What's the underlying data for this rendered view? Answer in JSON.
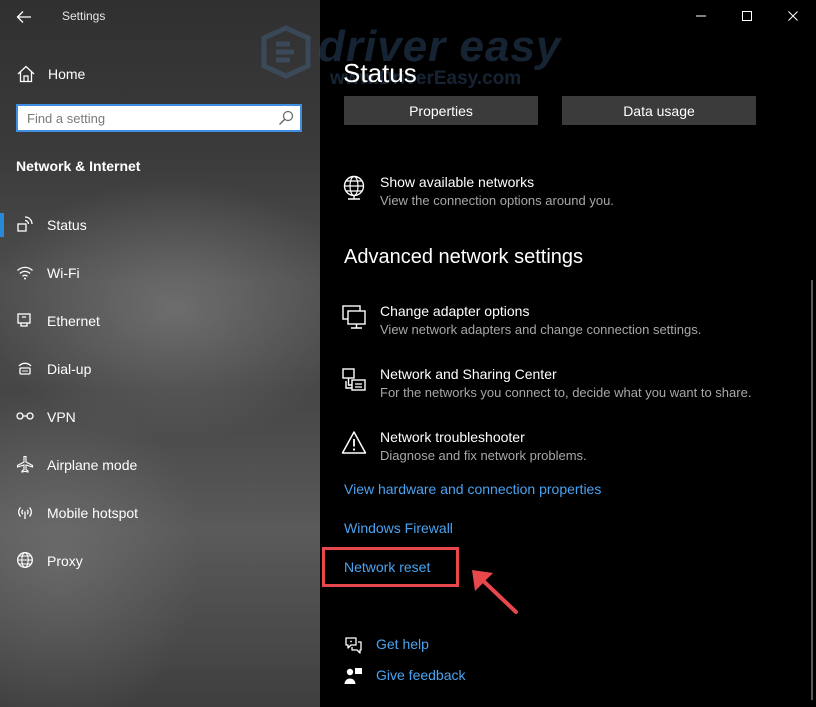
{
  "window": {
    "app_title": "Settings",
    "controls": [
      "minimize",
      "maximize",
      "close"
    ]
  },
  "watermark": {
    "brand": "driver easy",
    "url": "www.DriverEasy.com"
  },
  "sidebar": {
    "home_label": "Home",
    "search_placeholder": "Find a setting",
    "search_value": "",
    "section_title": "Network & Internet",
    "items": [
      {
        "label": "Status",
        "icon": "status-icon",
        "active": true
      },
      {
        "label": "Wi-Fi",
        "icon": "wifi-icon"
      },
      {
        "label": "Ethernet",
        "icon": "ethernet-icon"
      },
      {
        "label": "Dial-up",
        "icon": "dialup-icon"
      },
      {
        "label": "VPN",
        "icon": "vpn-icon"
      },
      {
        "label": "Airplane mode",
        "icon": "airplane-icon"
      },
      {
        "label": "Mobile hotspot",
        "icon": "hotspot-icon"
      },
      {
        "label": "Proxy",
        "icon": "globe-icon"
      }
    ]
  },
  "main": {
    "title": "Status",
    "buttons": {
      "properties": "Properties",
      "data_usage": "Data usage"
    },
    "show_networks": {
      "title": "Show available networks",
      "desc": "View the connection options around you."
    },
    "advanced_title": "Advanced network settings",
    "options": [
      {
        "title": "Change adapter options",
        "desc": "View network adapters and change connection settings.",
        "icon": "adapter-icon"
      },
      {
        "title": "Network and Sharing Center",
        "desc": "For the networks you connect to, decide what you want to share.",
        "icon": "sharing-center-icon"
      },
      {
        "title": "Network troubleshooter",
        "desc": "Diagnose and fix network problems.",
        "icon": "warning-icon"
      }
    ],
    "links": {
      "hardware": "View hardware and connection properties",
      "firewall": "Windows Firewall",
      "reset": "Network reset"
    },
    "help": {
      "get_help": "Get help",
      "feedback": "Give feedback"
    }
  },
  "colors": {
    "accent": "#2b88d8",
    "link": "#4aa3f0",
    "highlight": "#e8474c",
    "button_bg": "#3b3b3b"
  }
}
